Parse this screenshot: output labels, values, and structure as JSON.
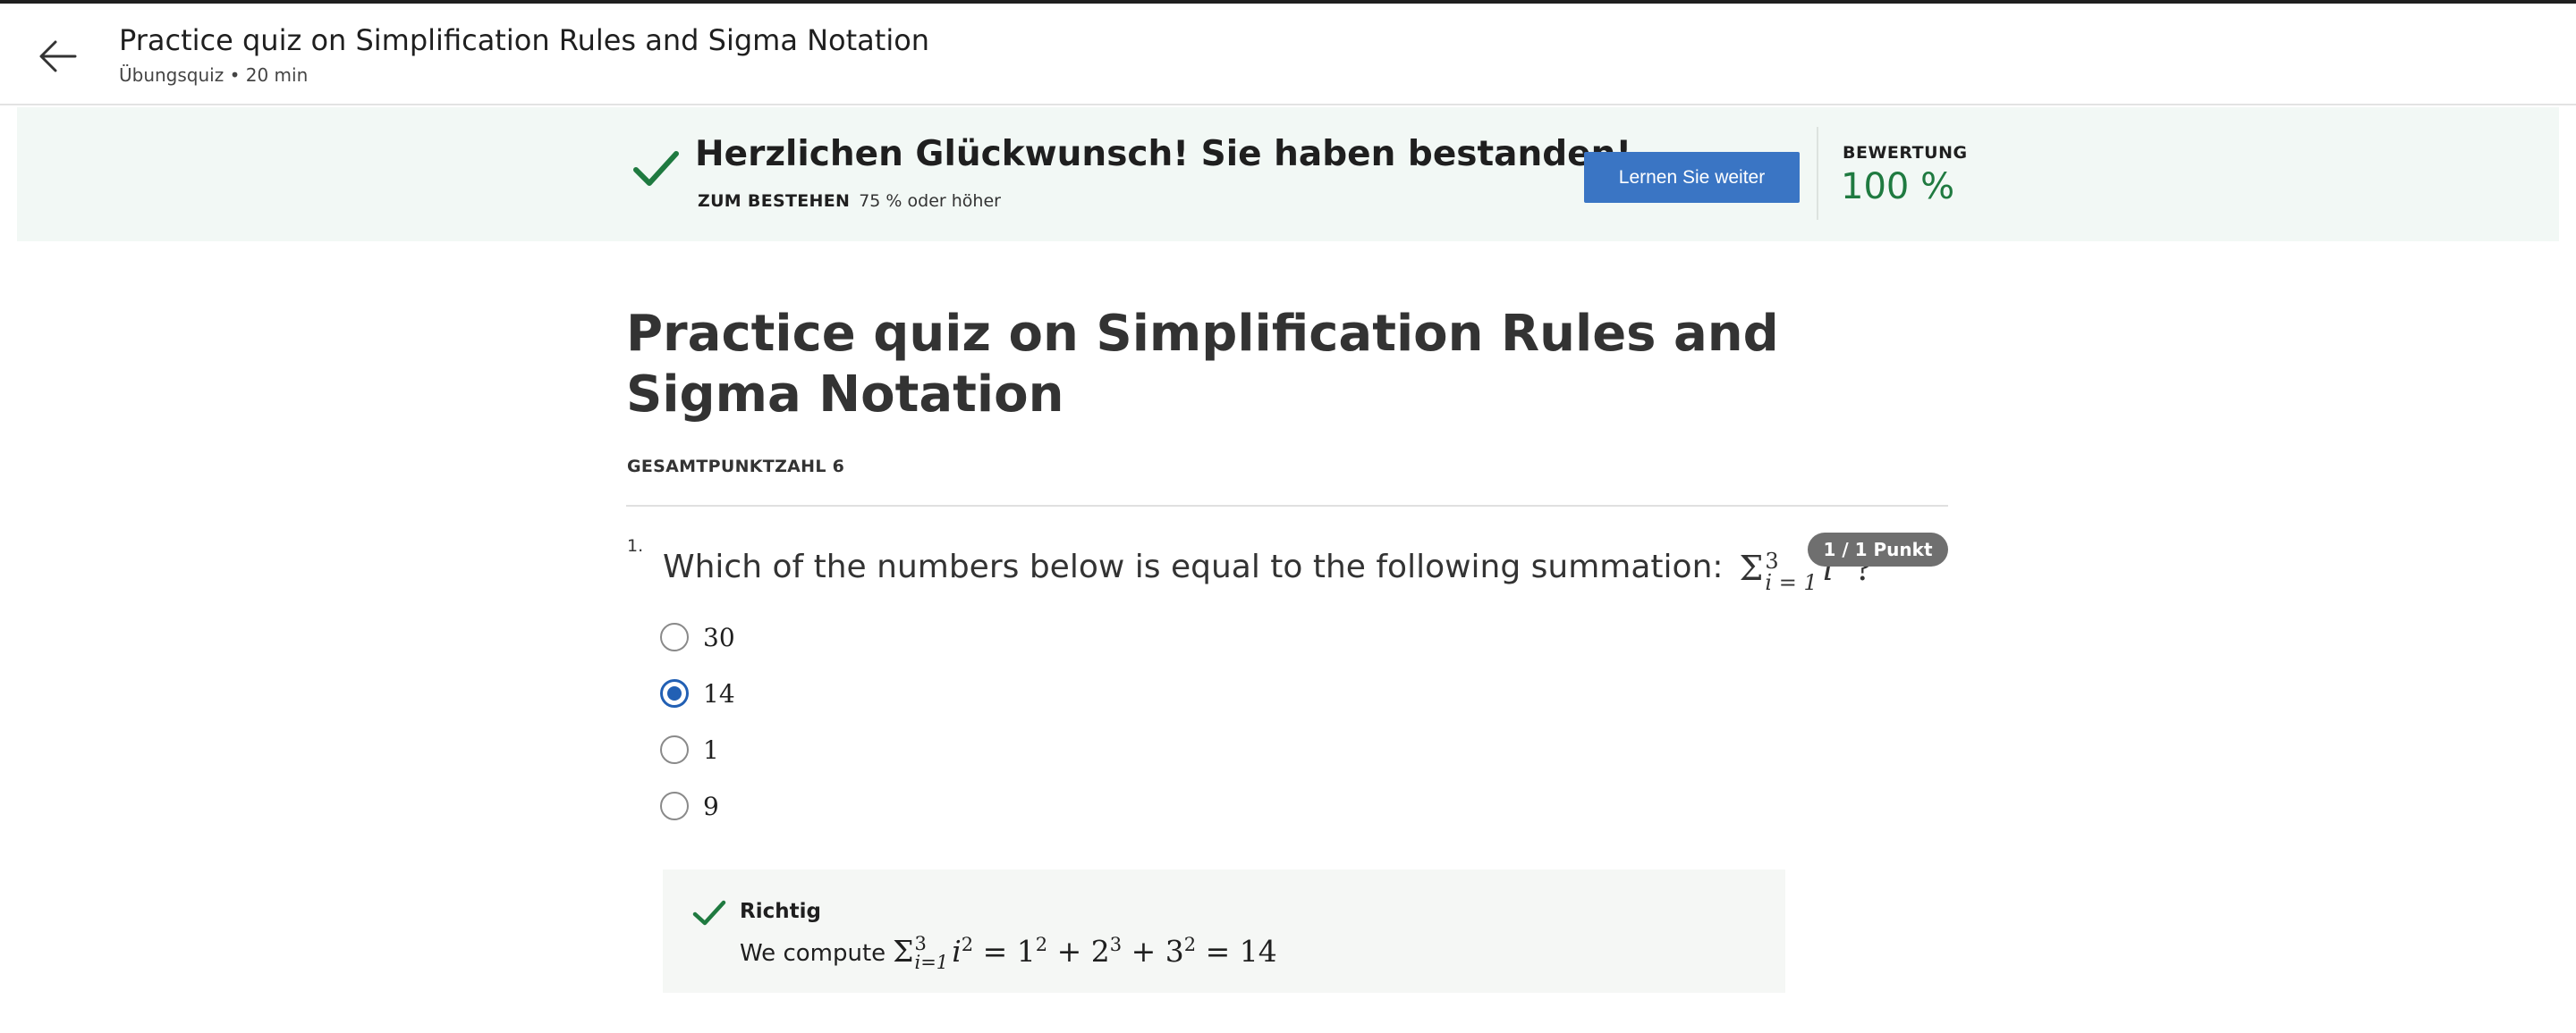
{
  "header": {
    "title": "Practice quiz on Simplification Rules and Sigma Notation",
    "subtitle": "Übungsquiz • 20 min",
    "back_icon": "arrow-left-icon"
  },
  "banner": {
    "title": "Herzlichen Glückwunsch! Sie haben bestanden!",
    "pass_label": "ZUM BESTEHEN",
    "pass_value": "75 % oder höher",
    "continue_button": "Lernen Sie weiter",
    "grade_label": "BEWERTUNG",
    "grade_value": "100 %",
    "check_icon": "check-icon",
    "colors": {
      "banner_bg": "#f2f8f5",
      "success": "#1f7a40",
      "button": "#3a75c4"
    }
  },
  "quiz": {
    "title": "Practice quiz on Simplification Rules and Sigma Notation",
    "total_points": "GESAMTPUNKTZAHL 6"
  },
  "question": {
    "number": "1.",
    "text": "Which of the numbers below is equal to the following summation:",
    "math": {
      "sigma": "Σ",
      "lower": "i = 1",
      "upper": "3",
      "term": "i",
      "power": "2",
      "end": "?"
    },
    "points": "1 / 1 Punkt",
    "options": [
      {
        "label": "30",
        "selected": false
      },
      {
        "label": "14",
        "selected": true
      },
      {
        "label": "1",
        "selected": false
      },
      {
        "label": "9",
        "selected": false
      }
    ]
  },
  "feedback": {
    "status": "Richtig",
    "text": "We compute",
    "math": {
      "sigma": "Σ",
      "upper": "3",
      "lower": "i=1",
      "term": "i",
      "power": "2",
      "rest": "= 1",
      "p1": "2",
      "plus1": "+ 2",
      "p2": "3",
      "plus2": "+ 3",
      "p3": "2",
      "result": "= 14"
    }
  }
}
